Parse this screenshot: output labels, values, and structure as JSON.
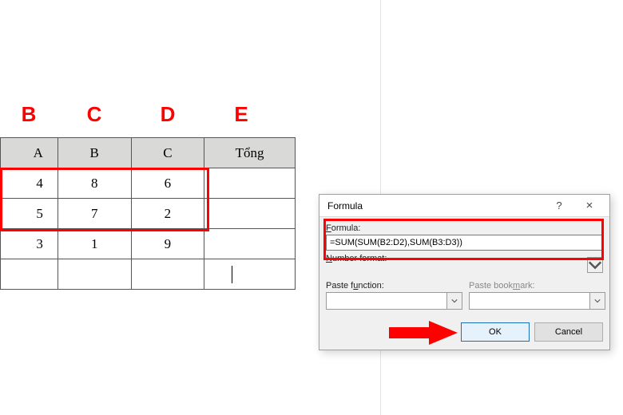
{
  "column_letters": [
    "B",
    "C",
    "D",
    "E"
  ],
  "table": {
    "headers": [
      "A",
      "B",
      "C",
      "Tổng"
    ],
    "rows": [
      [
        "4",
        "8",
        "6",
        ""
      ],
      [
        "5",
        "7",
        "2",
        ""
      ],
      [
        "3",
        "1",
        "9",
        ""
      ],
      [
        "",
        "",
        "",
        ""
      ]
    ]
  },
  "dialog": {
    "title": "Formula",
    "labels": {
      "formula": "Formula:",
      "number_format": "Number format:",
      "paste_function": "Paste function:",
      "paste_bookmark": "Paste bookmark:"
    },
    "formula_value": "=SUM(SUM(B2:D2),SUM(B3:D3))",
    "number_format_value": "",
    "paste_function_value": "",
    "paste_bookmark_value": "",
    "buttons": {
      "ok": "OK",
      "cancel": "Cancel"
    },
    "help_char": "?",
    "close_char": "×"
  },
  "colors": {
    "annotation_red": "#ff0000"
  }
}
